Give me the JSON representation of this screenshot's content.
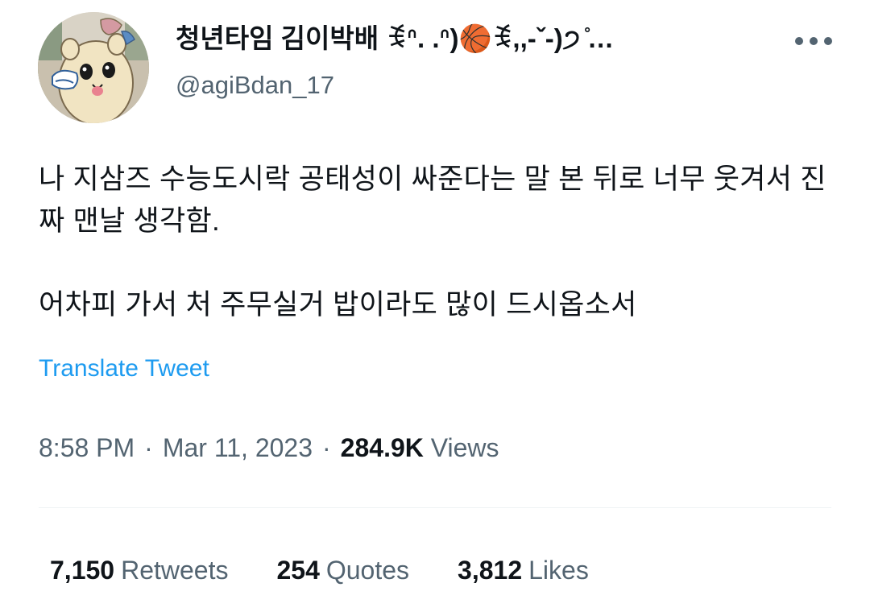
{
  "tweet": {
    "author": {
      "display_name": "청년타임 김이박배 ꉂᐢ. .ᐢ)🏀ꉂ,,-ˇ-)੭ ̊…",
      "handle": "@agiBdan_17",
      "avatar_icon": "cartoon-hamster-avatar"
    },
    "more_icon": "more-dots-icon",
    "text_paragraphs": [
      "나 지삼즈 수능도시락 공태성이 싸준다는 말 본 뒤로 너무 웃겨서 진짜 맨날 생각함.",
      "어차피 가서 처 주무실거 밥이라도 많이 드시옵소서"
    ],
    "translate_label": "Translate Tweet",
    "time": "8:58 PM",
    "date": "Mar 11, 2023",
    "separator": "·",
    "views_count": "284.9K",
    "views_label": "Views",
    "stats": {
      "retweets": {
        "count": "7,150",
        "label": "Retweets"
      },
      "quotes": {
        "count": "254",
        "label": "Quotes"
      },
      "likes": {
        "count": "3,812",
        "label": "Likes"
      }
    }
  },
  "colors": {
    "text_primary": "#0f1419",
    "text_secondary": "#536471",
    "link": "#1d9bf0",
    "divider": "#eff3f4"
  }
}
